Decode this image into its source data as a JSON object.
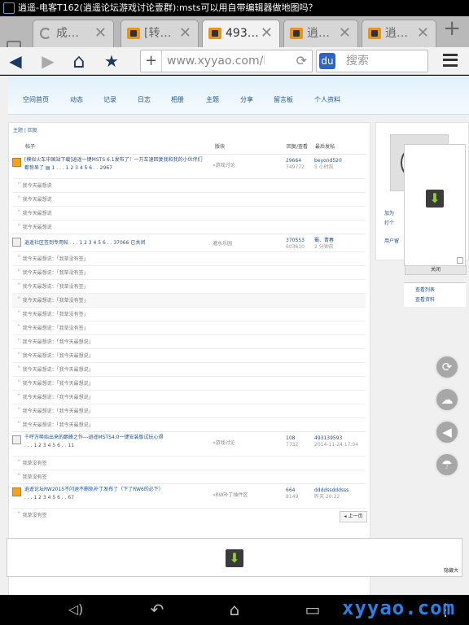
{
  "status_bar": {
    "title": "逍遥-电客T162(逍遥论坛游戏讨论壹群):msts可以用自带编辑器做地图吗？"
  },
  "tabs": [
    {
      "label": "成…",
      "close": "✕"
    },
    {
      "label": "[转…",
      "close": "✕"
    },
    {
      "label": "493…",
      "close": "✕"
    },
    {
      "label": "逍…",
      "close": "✕"
    },
    {
      "label": "逍…",
      "close": "✕"
    }
  ],
  "new_tab": "+",
  "toolbar": {
    "back": "◀",
    "forward": "▶",
    "home": "⌂",
    "bookmark": "★",
    "add": "+",
    "url": "www.xyyao.com/hc 颶",
    "reload": "⟳",
    "search_engine": "du",
    "search_placeholder": "搜索"
  },
  "site_nav": [
    "空间首页",
    "动态",
    "记录",
    "日志",
    "相册",
    "主题",
    "分享",
    "留言板",
    "个人资料"
  ],
  "breadcrumb": "主题 | 回复",
  "table_headers": {
    "post": "帖子",
    "forum": "版块",
    "stats": "回复/查看",
    "last": "最后发帖"
  },
  "threads": [
    {
      "title": "[模拟火车中国站下载]逍遥一键MSTS 6.1发布了！一万车速回复我和我的小伙伴们都惊呆了 ▤ 1 . . . 1 2 3 4 5 6 . . 2967",
      "forum": "»游戏讨论",
      "replies": "29664",
      "views": "749772",
      "last_user": "beyond520",
      "last_time": "5 小时前",
      "hot": true
    },
    {
      "title": "逍遥社区签到专用帖 . . . 1 2 3 4 5 6 . . 37066 已关闭",
      "forum": "灌水乐园",
      "replies": "370553",
      "views": "603610",
      "last_user": "蜀、青春",
      "last_time": "2 分钟前",
      "hot": false
    },
    {
      "title": "千呼万唤始出来的巅峰之作---逍遥MSTS4.0一键安装版试玩心得",
      "pages": ". . . 1 2 3 4 5 6 . . 11",
      "forum": "»游戏讨论",
      "replies": "108",
      "views": "7732",
      "last_user": "493139593",
      "last_time": "2014-11-24 17:04",
      "hot": false
    },
    {
      "title": "逍遥论坛RW2015不闪退不删轨补丁发布了（下了RW6的必下）",
      "pages": ". . . 1 2 3 4 5 6 . . 67",
      "forum": "»RW补丁插件区",
      "replies": "664",
      "views": "8149",
      "last_user": "ddddssdddsss",
      "last_time": "昨天 20:22",
      "hot": false
    }
  ],
  "replies": {
    "group1": [
      "我今天最想说",
      "我今天最想说",
      "我今天最想说",
      "我今天最想说"
    ],
    "group2": [
      "我今天最想说：「我草没有签」",
      "我今天最想说：「我草没有签」",
      "我今天最想说：「我草没有签」",
      "我今天最想说：「我草没有签」",
      "我今天最想说：「我草没有签」",
      "我今天最想说：「我草没有签」",
      "我今天最想说：「我今天最想说」",
      "我今天最想说：「我今天最想说」",
      "我今天最想说：「我今天最想说」",
      "我今天最想说：「我今天最想说」",
      "我今天最想说：「我今天最想说」",
      "我今天最想说：「我今天最想说」",
      "我今天最想说：「我今天最想说」"
    ],
    "group3": [
      "我草没有签",
      "我草没有签"
    ],
    "group4": [
      "我草没有签"
    ]
  },
  "prev_page": "上一页",
  "sidebar": {
    "links": [
      "加为",
      "打个",
      "用户留"
    ],
    "menu": [
      "查看列表",
      "查看资料"
    ]
  },
  "popup": {
    "close_label": "关闭"
  },
  "float_buttons": [
    "⟳",
    "☁",
    "◀",
    "☂"
  ],
  "bottom_ad": {
    "small": "隐藏大"
  },
  "navbar": [
    "◁)",
    "↶",
    "⌂",
    "▭",
    "⋮"
  ],
  "watermark": "xyyao.com",
  "colors": {
    "link": "#1d4f93",
    "hot_icon": "#f4a21b",
    "download_arrow": "#8fd22f",
    "watermark": "#2d7fe0"
  }
}
